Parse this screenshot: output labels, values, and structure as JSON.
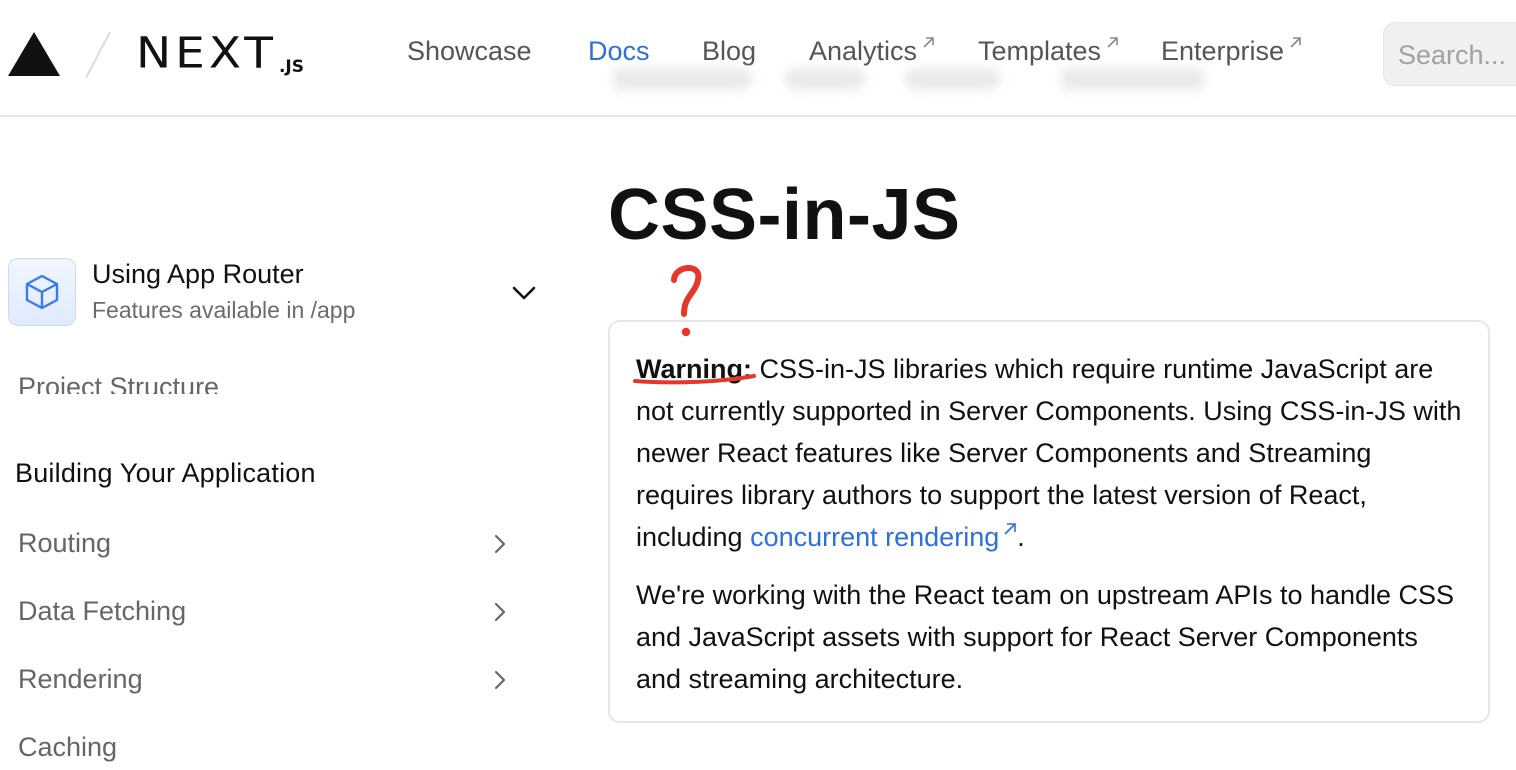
{
  "header": {
    "logo_main": "NEXT",
    "logo_sub": ".JS",
    "nav": [
      {
        "label": "Showcase",
        "external": false,
        "active": false
      },
      {
        "label": "Docs",
        "external": false,
        "active": true
      },
      {
        "label": "Blog",
        "external": false,
        "active": false
      },
      {
        "label": "Analytics",
        "external": true,
        "active": false
      },
      {
        "label": "Templates",
        "external": true,
        "active": false
      },
      {
        "label": "Enterprise",
        "external": true,
        "active": false
      }
    ],
    "search_placeholder": "Search..."
  },
  "sidebar": {
    "router_switch": {
      "title": "Using App Router",
      "subtitle": "Features available in /app"
    },
    "clipped_item": "Project Structure",
    "section_heading": "Building Your Application",
    "items": [
      {
        "label": "Routing",
        "has_children": true
      },
      {
        "label": "Data Fetching",
        "has_children": true
      },
      {
        "label": "Rendering",
        "has_children": true
      },
      {
        "label": "Caching",
        "has_children": false
      }
    ]
  },
  "main": {
    "title": "CSS-in-JS",
    "callout": {
      "warning_label": "Warning:",
      "p1_text": " CSS-in-JS libraries which require runtime JavaScript are not currently supported in Server Components. Using CSS-in-JS with newer React features like Server Components and Streaming requires library authors to support the latest version of React, including ",
      "link_text": "concurrent rendering",
      "p1_end": ".",
      "p2_text": "We're working with the React team on upstream APIs to handle CSS and JavaScript assets with support for React Server Components and streaming architecture."
    }
  },
  "annotation": {
    "mark": "?",
    "color": "#e5382a"
  },
  "colors": {
    "accent_link": "#2f6fdb",
    "muted_text": "#666666",
    "border": "#e6e6e6"
  }
}
